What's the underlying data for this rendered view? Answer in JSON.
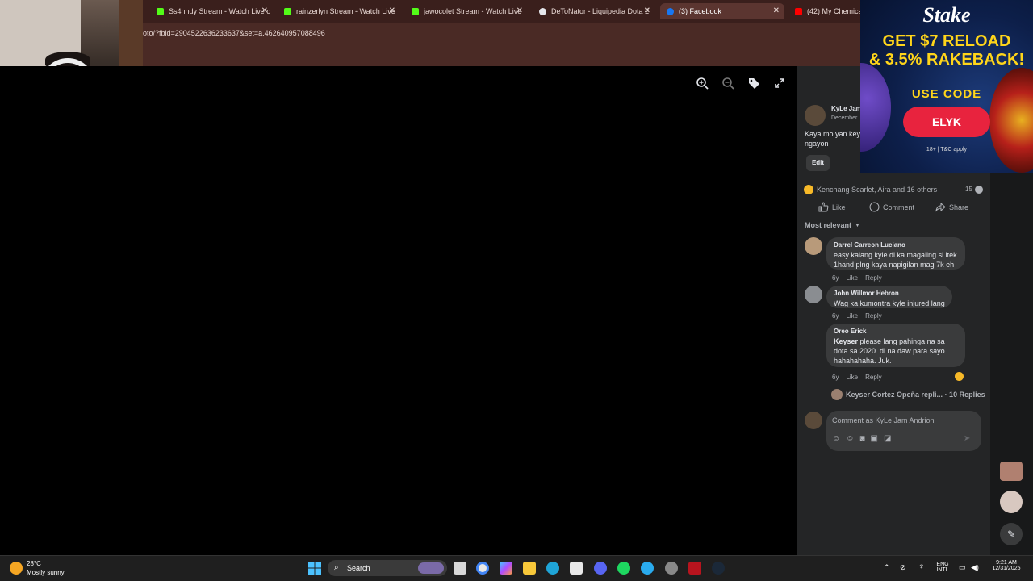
{
  "browser": {
    "tabs": [
      {
        "label": "Ss4nndy Stream - Watch Live o",
        "favicon_color": "#53fc18",
        "active": false
      },
      {
        "label": "rainzerlyn Stream - Watch Live",
        "favicon_color": "#53fc18",
        "active": false
      },
      {
        "label": "jawocolet Stream - Watch Live",
        "favicon_color": "#53fc18",
        "active": false
      },
      {
        "label": "DeToNator - Liquipedia Dota 2",
        "favicon_color": "#e4e6eb",
        "active": false
      },
      {
        "label": "(3) Facebook",
        "favicon_color": "#1877f2",
        "active": true
      },
      {
        "label": "(42) My Chemical R",
        "favicon_color": "#ff0000",
        "active": false
      }
    ],
    "url": "oto/?fbid=2904522636233637&set=a.462640957088496"
  },
  "post": {
    "author": "KyLe Jam",
    "date": "December",
    "caption_line1": "Kaya mo yan key",
    "caption_line2": "ngayon",
    "edit_label": "Edit",
    "reactions_text": "Kenchang Scarlet, Aira and 16 others",
    "comment_count": "15",
    "like_label": "Like",
    "comment_label": "Comment",
    "share_label": "Share",
    "sort_label": "Most relevant"
  },
  "comments": [
    {
      "name": "Darrel Carreon Luciano",
      "text_line1": "easy kalang kyle di ka magaling si itek",
      "text_line2": "1hand plng kaya napigilan mag 7k eh",
      "age": "6y",
      "like": "Like",
      "reply": "Reply"
    },
    {
      "name": "John Willmor Hebron",
      "text_line1": "Wag ka kumontra kyle injured lang",
      "age": "6y",
      "like": "Like",
      "reply": "Reply"
    },
    {
      "name": "Oreo Erick",
      "mention": "Keyser",
      "text_line1": " please lang pahinga na sa",
      "text_line2": "dota sa 2020. di na daw para sayo",
      "text_line3": "hahahahaha. Juk.",
      "age": "6y",
      "like": "Like",
      "reply": "Reply"
    }
  ],
  "replies_summary": {
    "text": "Keyser Cortez Opeña repli...",
    "count": "· 10 Replies"
  },
  "composer": {
    "placeholder": "Comment as KyLe Jam Andrion"
  },
  "ad": {
    "logo": "Stake",
    "headline_line1": "GET $7 RELOAD",
    "headline_line2": "& 3.5% RAKEBACK!",
    "use_code": "USE CODE",
    "code": "ELYK",
    "terms": "18+ | T&C apply"
  },
  "taskbar": {
    "temperature": "28°C",
    "weather": "Mostly sunny",
    "search_label": "Search",
    "lang_line1": "ENG",
    "lang_line2": "INTL",
    "time": "9:21 AM",
    "date": "12/31/2025"
  }
}
